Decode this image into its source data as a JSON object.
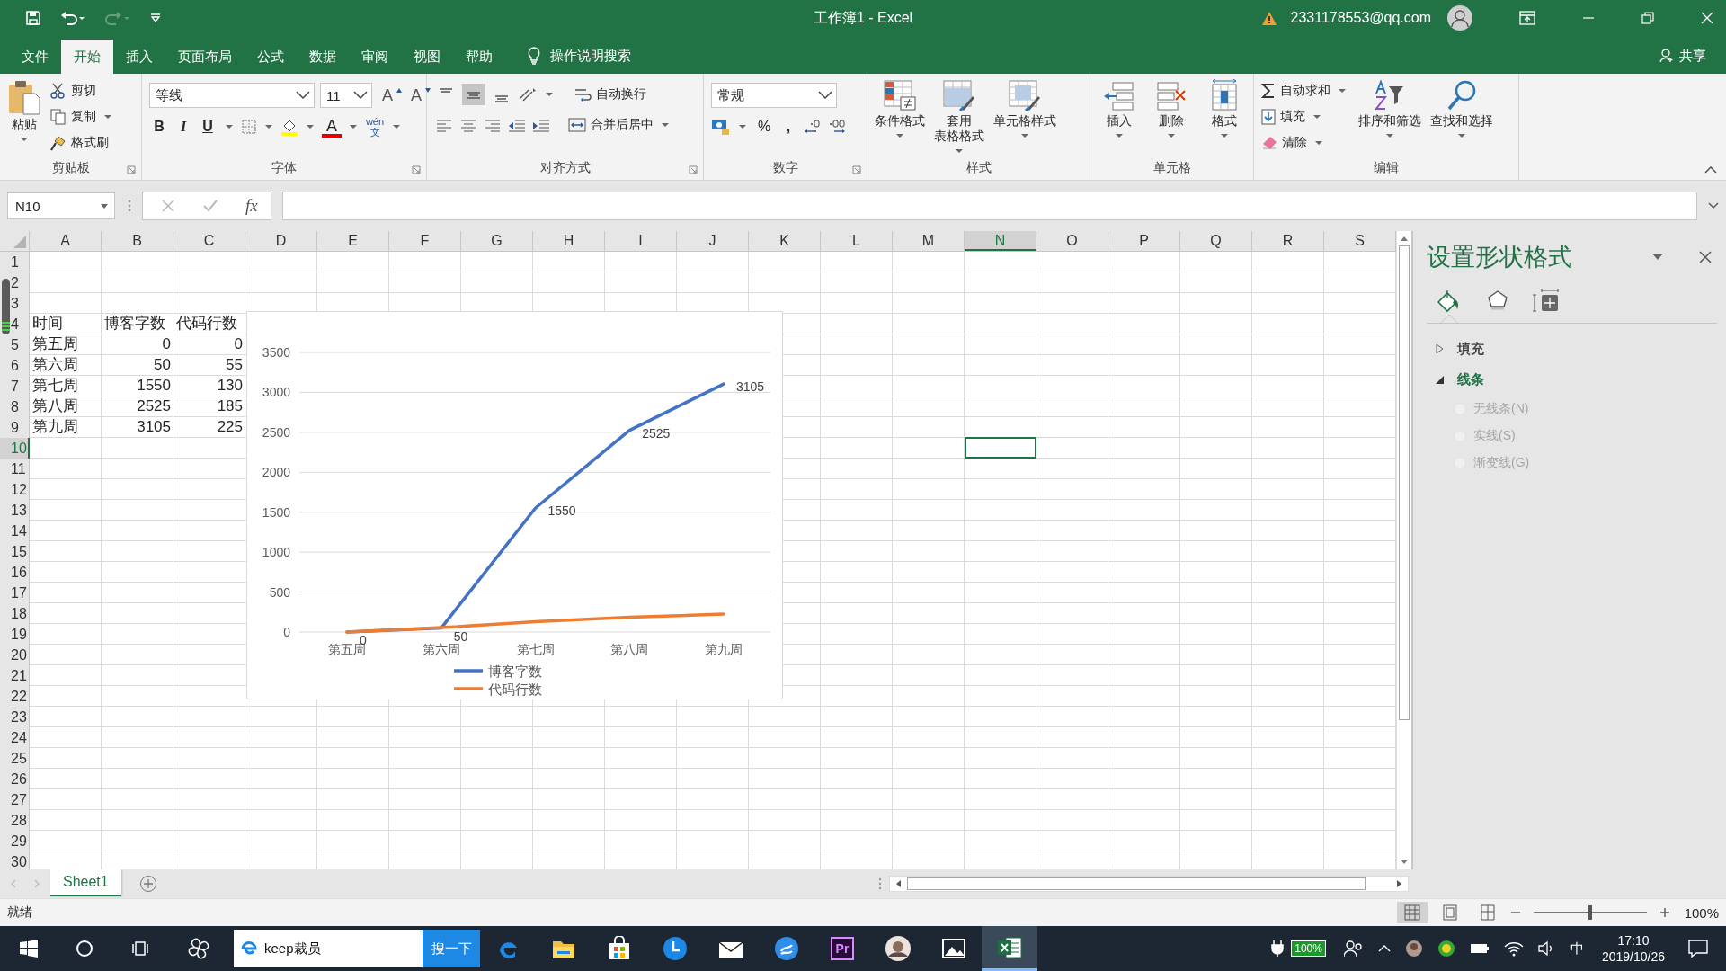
{
  "title_bar": {
    "title": "工作簿1  -  Excel",
    "account": "2331178553@qq.com"
  },
  "ribbon_tabs": [
    {
      "label": "文件",
      "selected": false
    },
    {
      "label": "开始",
      "selected": true
    },
    {
      "label": "插入",
      "selected": false
    },
    {
      "label": "页面布局",
      "selected": false
    },
    {
      "label": "公式",
      "selected": false
    },
    {
      "label": "数据",
      "selected": false
    },
    {
      "label": "审阅",
      "selected": false
    },
    {
      "label": "视图",
      "selected": false
    },
    {
      "label": "帮助",
      "selected": false
    }
  ],
  "tell_me": {
    "placeholder": "操作说明搜索"
  },
  "share": "共享",
  "ribbon": {
    "clipboard": {
      "label": "剪贴板",
      "paste": "粘贴",
      "cut": "剪切",
      "copy": "复制",
      "format_painter": "格式刷"
    },
    "font": {
      "label": "字体",
      "font_name": "等线",
      "font_size": "11",
      "grow": "A",
      "shrink": "A",
      "bold": "B",
      "italic": "I",
      "underline": "U",
      "font_color": "A",
      "phonetic_top": "wén",
      "phonetic_bottom": "文"
    },
    "alignment": {
      "label": "对齐方式",
      "vertical_align": [
        {
          "selected": false
        },
        {
          "selected": true
        },
        {
          "selected": false
        }
      ],
      "wrap_text": "自动换行",
      "merge_center": "合并后居中"
    },
    "number": {
      "label": "数字",
      "format": "常规",
      "percent": "%",
      "comma": ","
    },
    "styles": {
      "label": "样式",
      "buttons": [
        {
          "kind": "conditional",
          "lines": [
            "条件格式"
          ]
        },
        {
          "kind": "table",
          "lines": [
            "套用",
            "表格格式"
          ]
        },
        {
          "kind": "cell",
          "lines": [
            "单元格样式"
          ]
        }
      ]
    },
    "cells": {
      "label": "单元格",
      "buttons": [
        {
          "kind": "insert",
          "label": "插入"
        },
        {
          "kind": "delete",
          "label": "删除"
        },
        {
          "kind": "format",
          "label": "格式"
        }
      ]
    },
    "editing": {
      "label": "编辑",
      "autosum": "自动求和",
      "fill": "填充",
      "clear": "清除",
      "sort_filter": "排序和筛选",
      "find_select": "查找和选择"
    }
  },
  "formula_bar": {
    "name_box": "N10",
    "fx": "fx"
  },
  "sheet": {
    "columns": [
      {
        "label": "A",
        "selected": false
      },
      {
        "label": "B",
        "selected": false
      },
      {
        "label": "C",
        "selected": false
      },
      {
        "label": "D",
        "selected": false
      },
      {
        "label": "E",
        "selected": false
      },
      {
        "label": "F",
        "selected": false
      },
      {
        "label": "G",
        "selected": false
      },
      {
        "label": "H",
        "selected": false
      },
      {
        "label": "I",
        "selected": false
      },
      {
        "label": "J",
        "selected": false
      },
      {
        "label": "K",
        "selected": false
      },
      {
        "label": "L",
        "selected": false
      },
      {
        "label": "M",
        "selected": false
      },
      {
        "label": "N",
        "selected": true
      },
      {
        "label": "O",
        "selected": false
      },
      {
        "label": "P",
        "selected": false
      },
      {
        "label": "Q",
        "selected": false
      },
      {
        "label": "R",
        "selected": false
      },
      {
        "label": "S",
        "selected": false
      }
    ],
    "rows": [
      {
        "header": "1",
        "selected": false
      },
      {
        "header": "2",
        "selected": false
      },
      {
        "header": "3",
        "selected": false
      },
      {
        "header": "4",
        "selected": false,
        "cells": [
          {
            "text": "时间",
            "kind": "text"
          },
          {
            "text": "博客字数",
            "kind": "text"
          },
          {
            "text": "代码行数",
            "kind": "text"
          }
        ]
      },
      {
        "header": "5",
        "selected": false,
        "cells": [
          {
            "text": "第五周",
            "kind": "text"
          },
          {
            "text": "0",
            "kind": "number"
          },
          {
            "text": "0",
            "kind": "number"
          }
        ]
      },
      {
        "header": "6",
        "selected": false,
        "cells": [
          {
            "text": "第六周",
            "kind": "text"
          },
          {
            "text": "50",
            "kind": "number"
          },
          {
            "text": "55",
            "kind": "number"
          }
        ]
      },
      {
        "header": "7",
        "selected": false,
        "cells": [
          {
            "text": "第七周",
            "kind": "text"
          },
          {
            "text": "1550",
            "kind": "number"
          },
          {
            "text": "130",
            "kind": "number"
          }
        ]
      },
      {
        "header": "8",
        "selected": false,
        "cells": [
          {
            "text": "第八周",
            "kind": "text"
          },
          {
            "text": "2525",
            "kind": "number"
          },
          {
            "text": "185",
            "kind": "number"
          }
        ]
      },
      {
        "header": "9",
        "selected": false,
        "cells": [
          {
            "text": "第九周",
            "kind": "text"
          },
          {
            "text": "3105",
            "kind": "number"
          },
          {
            "text": "225",
            "kind": "number"
          }
        ]
      },
      {
        "header": "10",
        "selected": true
      },
      {
        "header": "11",
        "selected": false
      },
      {
        "header": "12",
        "selected": false
      },
      {
        "header": "13",
        "selected": false
      },
      {
        "header": "14",
        "selected": false
      },
      {
        "header": "15",
        "selected": false
      },
      {
        "header": "16",
        "selected": false
      },
      {
        "header": "17",
        "selected": false
      },
      {
        "header": "18",
        "selected": false
      },
      {
        "header": "19",
        "selected": false
      },
      {
        "header": "20",
        "selected": false
      },
      {
        "header": "21",
        "selected": false
      },
      {
        "header": "22",
        "selected": false
      },
      {
        "header": "23",
        "selected": false
      },
      {
        "header": "24",
        "selected": false
      },
      {
        "header": "25",
        "selected": false
      },
      {
        "header": "26",
        "selected": false
      },
      {
        "header": "27",
        "selected": false
      },
      {
        "header": "28",
        "selected": false
      },
      {
        "header": "29",
        "selected": false
      },
      {
        "header": "30",
        "selected": false
      }
    ]
  },
  "chart": {
    "chart_data": {
      "type": "line",
      "categories": [
        "第五周",
        "第六周",
        "第七周",
        "第八周",
        "第九周"
      ],
      "series": [
        {
          "name": "博客字数",
          "color": "#4472c4",
          "values": [
            0,
            50,
            1550,
            2525,
            3105
          ],
          "data_labels": true
        },
        {
          "name": "代码行数",
          "color": "#ed7d31",
          "values": [
            0,
            55,
            130,
            185,
            225
          ],
          "data_labels": false
        }
      ],
      "ylim": [
        0,
        3500
      ],
      "yticks": [
        0,
        500,
        1000,
        1500,
        2000,
        2500,
        3000,
        3500
      ],
      "data_labels": true,
      "grid": true,
      "legend": true
    }
  },
  "format_pane": {
    "title": "设置形状格式",
    "tabs": [
      {
        "kind": "fill",
        "selected": true
      },
      {
        "kind": "effects",
        "selected": false
      },
      {
        "kind": "size",
        "selected": false
      }
    ],
    "sections": [
      {
        "label": "填充",
        "expanded": false
      },
      {
        "label": "线条",
        "expanded": true,
        "options": [
          {
            "label": "无线条(N)",
            "selected": false,
            "disabled": true
          },
          {
            "label": "实线(S)",
            "selected": false,
            "disabled": true
          },
          {
            "label": "渐变线(G)",
            "selected": false,
            "disabled": true
          }
        ]
      }
    ]
  },
  "sheet_tabs": [
    {
      "label": "Sheet1",
      "selected": true
    }
  ],
  "status_bar": {
    "status": "就绪",
    "zoom": "100%",
    "zoom_slider": {
      "level": 0.5
    }
  },
  "taskbar": {
    "search": {
      "value": "keep裁员"
    },
    "search_button": "搜一下",
    "apps": [
      {
        "kind": "edge",
        "selected": false
      },
      {
        "kind": "folder",
        "selected": false
      },
      {
        "kind": "store",
        "selected": false
      },
      {
        "kind": "clock",
        "selected": false
      },
      {
        "kind": "mail",
        "selected": false
      },
      {
        "kind": "swirl",
        "selected": false
      },
      {
        "kind": "premiere",
        "label": "Pr",
        "selected": false
      },
      {
        "kind": "photo-app",
        "selected": false
      },
      {
        "kind": "photos",
        "selected": false
      },
      {
        "kind": "excel",
        "selected": true
      }
    ],
    "battery": "100%",
    "ime": "中",
    "time": "17:10",
    "date": "2019/10/26"
  }
}
